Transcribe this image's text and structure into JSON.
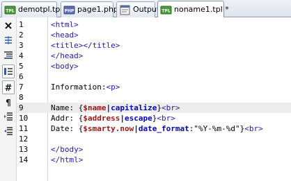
{
  "tabs": [
    {
      "label": "demotpl.tpl",
      "icon": "tpl-file-icon",
      "active": false
    },
    {
      "label": "page1.php",
      "icon": "php-file-icon",
      "active": false
    },
    {
      "label": "Output",
      "icon": "output-icon",
      "active": false
    },
    {
      "label": "noname1.tpl *",
      "icon": "tpl-file-icon",
      "active": true
    }
  ],
  "toolbar": [
    {
      "icon": "close-icon"
    },
    {
      "icon": "wrap-icon"
    },
    {
      "icon": "indent-guides-icon"
    },
    {
      "icon": "show-selection-icon"
    },
    {
      "icon": "line-numbers-icon"
    },
    {
      "icon": "paragraph-marks-icon"
    },
    {
      "icon": "indent-icon"
    },
    {
      "icon": "unindent-icon"
    }
  ],
  "editor": {
    "current_line": 9,
    "lines": [
      {
        "n": "1",
        "code": "<html>"
      },
      {
        "n": "2",
        "code": "<head>"
      },
      {
        "n": "3",
        "code": "<title></title>"
      },
      {
        "n": "4",
        "code": "</head>"
      },
      {
        "n": "5",
        "code": "<body>"
      },
      {
        "n": "6",
        "code": ""
      },
      {
        "n": "7",
        "code": "Information:<p>"
      },
      {
        "n": "8",
        "code": ""
      },
      {
        "n": "9",
        "code": "Name: {$name|capitalize}<br>"
      },
      {
        "n": "10",
        "code": "Addr: {$address|escape}<br>"
      },
      {
        "n": "11",
        "code": "Date: {$smarty.now|date_format:\"%Y-%m-%d\"}<br>"
      },
      {
        "n": "12",
        "code": ""
      },
      {
        "n": "13",
        "code": "</body>"
      },
      {
        "n": "14",
        "code": "</html>"
      }
    ]
  }
}
